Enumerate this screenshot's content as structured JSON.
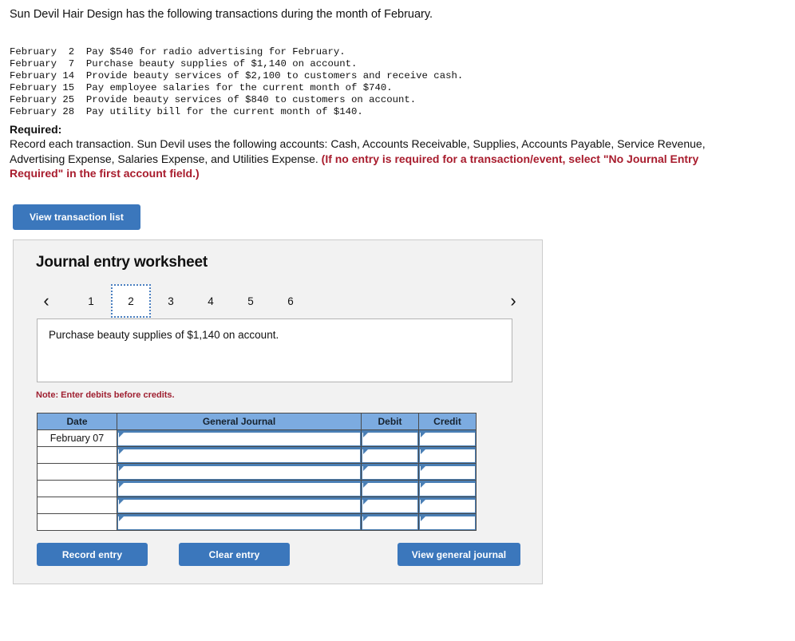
{
  "intro": {
    "text": "Sun Devil Hair Design has the following transactions during the month of February."
  },
  "transactions": {
    "lines": [
      "February  2  Pay $540 for radio advertising for February.",
      "February  7  Purchase beauty supplies of $1,140 on account.",
      "February 14  Provide beauty services of $2,100 to customers and receive cash.",
      "February 15  Pay employee salaries for the current month of $740.",
      "February 25  Provide beauty services of $840 to customers on account.",
      "February 28  Pay utility bill for the current month of $140."
    ],
    "block": "February  2  Pay $540 for radio advertising for February.\nFebruary  7  Purchase beauty supplies of $1,140 on account.\nFebruary 14  Provide beauty services of $2,100 to customers and receive cash.\nFebruary 15  Pay employee salaries for the current month of $740.\nFebruary 25  Provide beauty services of $840 to customers on account.\nFebruary 28  Pay utility bill for the current month of $140."
  },
  "required": {
    "label": "Required:",
    "body": "Record each transaction. Sun Devil uses the following accounts: Cash, Accounts Receivable, Supplies, Accounts Payable, Service Revenue, Advertising Expense, Salaries Expense, and Utilities Expense. ",
    "emphasis": "(If no entry is required for a transaction/event, select \"No Journal Entry Required\" in the first account field.)"
  },
  "buttons": {
    "view_transaction_list": "View transaction list",
    "record_entry": "Record entry",
    "clear_entry": "Clear entry",
    "view_general_journal": "View general journal"
  },
  "worksheet": {
    "title": "Journal entry worksheet",
    "prev_icon": "‹",
    "next_icon": "›",
    "tabs": [
      {
        "label": "1",
        "active": false
      },
      {
        "label": "2",
        "active": true
      },
      {
        "label": "3",
        "active": false
      },
      {
        "label": "4",
        "active": false
      },
      {
        "label": "5",
        "active": false
      },
      {
        "label": "6",
        "active": false
      }
    ],
    "active_tab": "2",
    "description": "Purchase beauty supplies of $1,140 on account.",
    "note": "Note: Enter debits before credits."
  },
  "journal_table": {
    "headers": [
      "Date",
      "General Journal",
      "Debit",
      "Credit"
    ],
    "rows": [
      {
        "date": "February 07",
        "general_journal": "",
        "debit": "",
        "credit": ""
      },
      {
        "date": "",
        "general_journal": "",
        "debit": "",
        "credit": ""
      },
      {
        "date": "",
        "general_journal": "",
        "debit": "",
        "credit": ""
      },
      {
        "date": "",
        "general_journal": "",
        "debit": "",
        "credit": ""
      },
      {
        "date": "",
        "general_journal": "",
        "debit": "",
        "credit": ""
      },
      {
        "date": "",
        "general_journal": "",
        "debit": "",
        "credit": ""
      }
    ]
  },
  "colors": {
    "button_blue": "#3b77bc",
    "table_header_blue": "#7cabe0",
    "alert_red": "#a81c2d",
    "note_red": "#9f2031",
    "panel_bg": "#f2f2f2",
    "input_border_blue": "#4a7fb5"
  }
}
